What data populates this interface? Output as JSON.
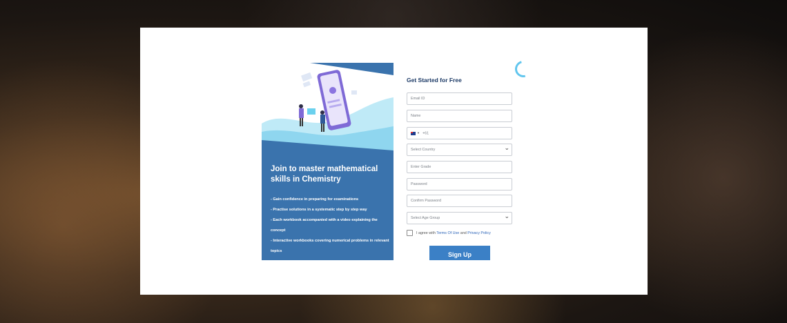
{
  "left_panel": {
    "title": "Join to master mathematical skills in Chemistry",
    "bullets": [
      "Gain confidence in preparing for examinations",
      "Practise solutions in a systematic step by step way",
      "Each workbook accompanied with a video explaining the concept",
      "Interactive workbooks covering numerical problems in relevant topics"
    ]
  },
  "form": {
    "title": "Get Started for Free",
    "email_placeholder": "Email ID",
    "name_placeholder": "Name",
    "phone_code": "+61",
    "country_select": "Select Country",
    "grade_placeholder": "Enter Grade",
    "password_placeholder": "Password",
    "confirm_password_placeholder": "Confirm Password",
    "age_group_select": "Select Age Group",
    "agree_prefix": "I agree with",
    "terms_link": "Terms Of Use",
    "agree_and": "and",
    "privacy_link": "Privacy Policy",
    "submit_label": "Sign Up"
  },
  "colors": {
    "left_panel_bg": "#3a73ad",
    "accent_button": "#3b80c6",
    "title_color": "#1c3a66"
  }
}
